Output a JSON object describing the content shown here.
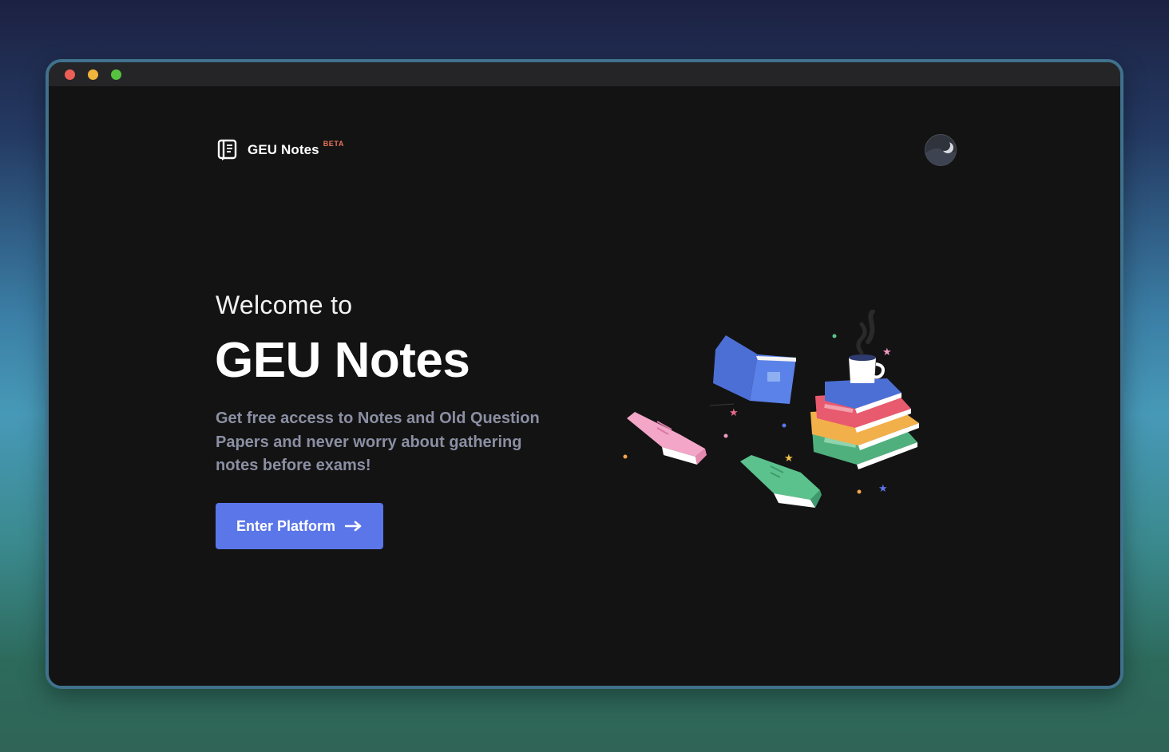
{
  "window": {
    "controls": [
      {
        "name": "close",
        "color": "#ec5f57"
      },
      {
        "name": "minimize",
        "color": "#f0b43c"
      },
      {
        "name": "maximize",
        "color": "#57c240"
      }
    ]
  },
  "header": {
    "brand_name": "GEU Notes",
    "badge": "BETA",
    "logo_icon": "notebook-icon",
    "theme_toggle_icon": "moon-icon"
  },
  "hero": {
    "welcome": "Welcome to",
    "title": "GEU Notes",
    "description": "Get free access to Notes and Old Question Papers and never worry about gathering notes before exams!",
    "cta_label": "Enter Platform",
    "cta_icon": "arrow-right-icon"
  },
  "illustration": {
    "icon": "books-illustration"
  },
  "colors": {
    "accent": "#5b76e8",
    "beta": "#e8755a",
    "background": "#131313"
  }
}
